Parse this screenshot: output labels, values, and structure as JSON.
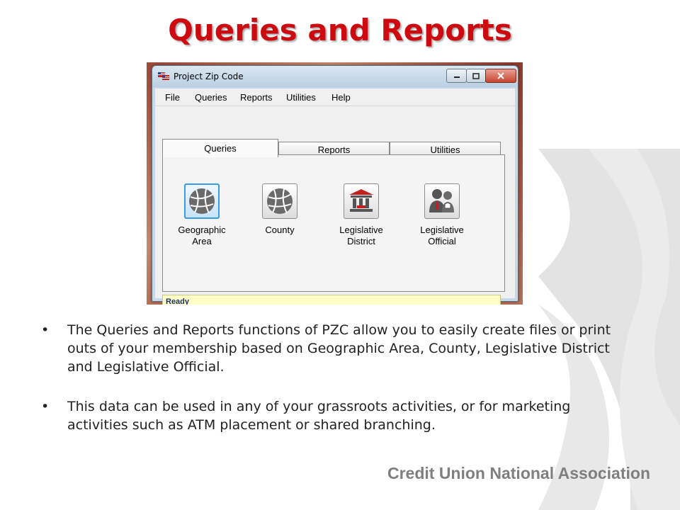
{
  "slide": {
    "title": "Queries and Reports",
    "bullets": [
      " The Queries and Reports functions of PZC allow you to easily create files or print outs of your membership based on Geographic Area, County, Legislative District and Legislative Official.",
      "This data can be used in any of your grassroots activities, or for marketing activities such as ATM placement or shared branching."
    ],
    "bullet_char": "•",
    "footer": "Credit Union National Association"
  },
  "window": {
    "title": "Project Zip Code",
    "menu": [
      "File",
      "Queries",
      "Reports",
      "Utilities",
      "Help"
    ],
    "tabs": [
      "Queries",
      "Reports",
      "Utilities"
    ],
    "active_tab": "Queries",
    "query_buttons": [
      {
        "label": "Geographic\nArea",
        "icon": "globe-grid-icon",
        "selected": true
      },
      {
        "label": "County",
        "icon": "globe-grid-icon",
        "selected": false
      },
      {
        "label": "Legislative\nDistrict",
        "icon": "capitol-building-icon",
        "selected": false
      },
      {
        "label": "Legislative\nOfficial",
        "icon": "officials-icon",
        "selected": false
      }
    ],
    "status": "Ready"
  },
  "colors": {
    "title": "#cc0a10",
    "footer": "#7f7f7f",
    "status_bg": "#ffffc8",
    "selection": "#3b9ae0"
  }
}
